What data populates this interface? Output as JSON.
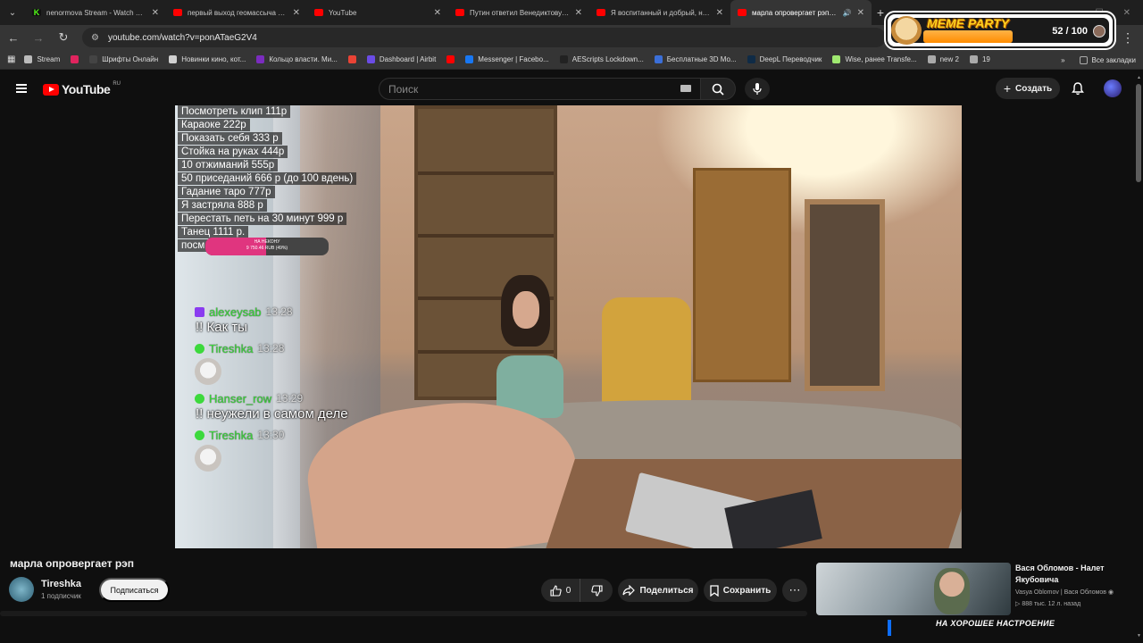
{
  "browser": {
    "tabs": [
      {
        "title": "nenormova Stream - Watch Live",
        "fav": "kick",
        "active": false
      },
      {
        "title": "первый выход геомассыча - YouTube",
        "fav": "youtube",
        "active": false
      },
      {
        "title": "YouTube",
        "fav": "youtube",
        "active": false
      },
      {
        "title": "Путин ответил Венедиктову - YouTube",
        "fav": "youtube",
        "active": false
      },
      {
        "title": "Я воспитанный и добрый, несу ...",
        "fav": "youtube",
        "active": false
      },
      {
        "title": "марла опровергает рэп - YouTube",
        "fav": "youtube",
        "active": true
      }
    ],
    "url": "youtube.com/watch?v=ponATaeG2V4",
    "bookmarks": [
      {
        "label": "Stream",
        "color": "#bbbbbb"
      },
      {
        "label": "",
        "color": "#e0245e"
      },
      {
        "label": "Шрифты Онлайн",
        "color": "#444444"
      },
      {
        "label": "Новинки кино, кот...",
        "color": "#d0d0d0"
      },
      {
        "label": "Кольцо власти. Ми...",
        "color": "#7b2cbf"
      },
      {
        "label": "",
        "color": "#ea4335"
      },
      {
        "label": "Dashboard | Airbit",
        "color": "#6b4ce6"
      },
      {
        "label": "",
        "color": "#ff0000"
      },
      {
        "label": "Messenger | Facebo...",
        "color": "#1877f2"
      },
      {
        "label": "AEScripts Lockdown...",
        "color": "#222222"
      },
      {
        "label": "Бесплатные 3D Мо...",
        "color": "#3b6fd8"
      },
      {
        "label": "DeepL Переводчик",
        "color": "#0f2b46"
      },
      {
        "label": "Wise, ранее Transfe...",
        "color": "#9fe870"
      },
      {
        "label": "new 2",
        "color": "#aaaaaa"
      },
      {
        "label": "19",
        "color": "#aaaaaa"
      }
    ],
    "all_bookmarks": "Все закладки"
  },
  "overlay": {
    "brand": "MEME PARTY",
    "count": "52 / 100"
  },
  "youtube": {
    "region": "RU",
    "search_placeholder": "Поиск",
    "create_label": "Создать"
  },
  "stream": {
    "donations": [
      "Посмотреть клип 111р",
      "Караоке 222р",
      "Показать себя 333 р",
      "Стойка на руках 444р",
      "10 отжиманий 555р",
      "50 приседаний 666 р (до 100 вдень)",
      "Гадание таро 777р",
      "Я застряла 888 р",
      "Перестать петь на 30 минут 999 р",
      "Танец 1111 р.",
      "посм"
    ],
    "goal": {
      "title": "НА НЕКОНУ",
      "amount": "9 750.46 RUB (49%)",
      "progress": 0.49
    },
    "chat": [
      {
        "user": "alexeysab",
        "time": "13:28",
        "text": "!! Как ты",
        "badge": "square",
        "emote": false
      },
      {
        "user": "Tireshka",
        "time": "13:28",
        "text": "",
        "badge": "dot",
        "emote": true
      },
      {
        "user": "Hanser_row",
        "time": "13:29",
        "text": "!! неужели в самом деле",
        "badge": "dot",
        "emote": false
      },
      {
        "user": "Tireshka",
        "time": "13:30",
        "text": "",
        "badge": "dot",
        "emote": true
      }
    ]
  },
  "video": {
    "title": "марла опровергает рэп",
    "channel": "Tireshka",
    "subscribers": "1 подписчик",
    "subscribe": "Подписаться",
    "likes": "0",
    "share": "Поделиться",
    "save": "Сохранить"
  },
  "recommendation": {
    "title": "Вася Обломов - Налет Якубовича",
    "channel": "Vasya Oblomov | Вася Обломов",
    "meta": "▷ 888 тыс.   12 л. назад",
    "banner": "НА ХОРОШЕЕ НАСТРОЕНИЕ"
  }
}
